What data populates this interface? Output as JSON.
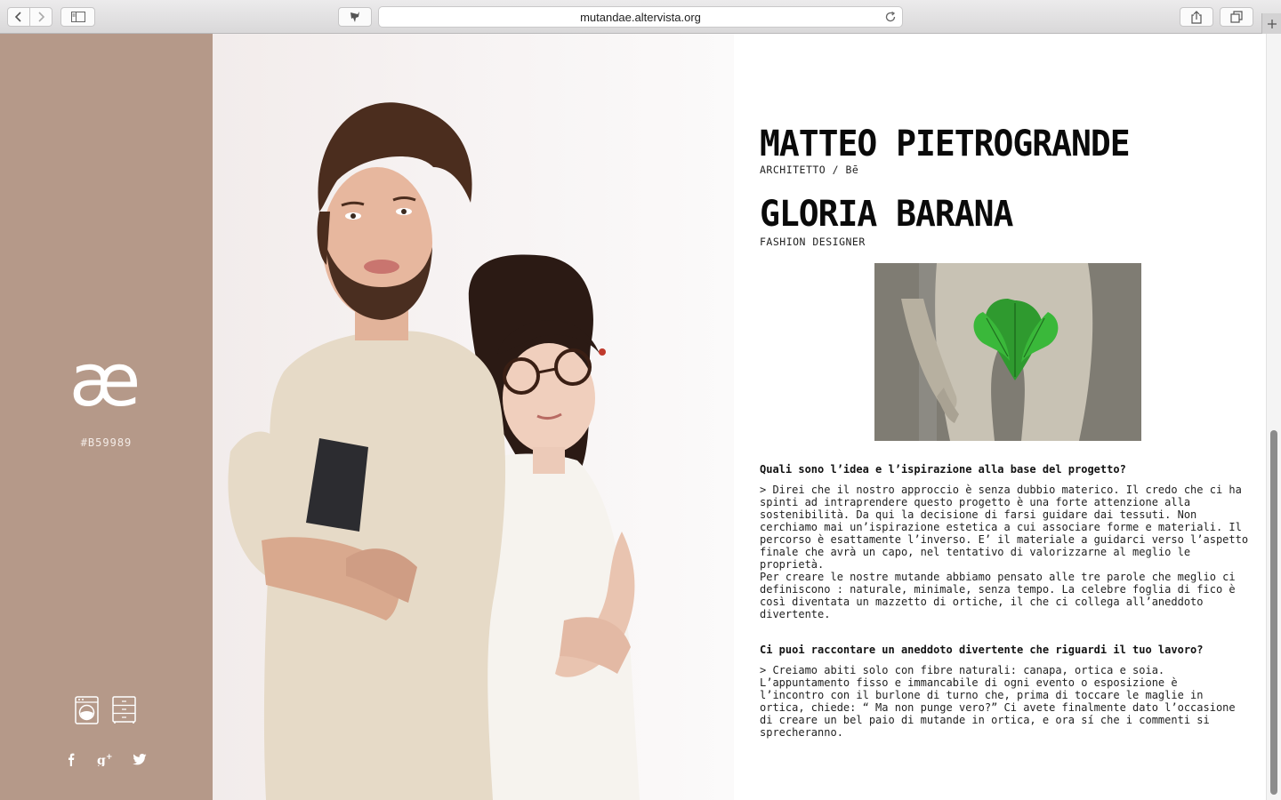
{
  "browser": {
    "url": "mutandae.altervista.org"
  },
  "sidebar": {
    "logo_glyph": "æ",
    "hex_color": "#B59989",
    "background": "#b59989",
    "tools": [
      "washing-machine-icon",
      "drawers-icon"
    ],
    "social": [
      "facebook-icon",
      "google-plus-icon",
      "twitter-icon"
    ]
  },
  "profile": {
    "person1": {
      "name": "MATTEO PIETROGRANDE",
      "role": "ARCHITETTO / Bē"
    },
    "person2": {
      "name": "GLORIA BARANA",
      "role": "FASHION DESIGNER"
    }
  },
  "interview": {
    "q1": "Quali sono l’idea e l’ispirazione alla base del progetto?",
    "a1": "> Direi che il nostro approccio è senza dubbio materico. Il credo che ci ha\nspinti ad intraprendere questo progetto è una forte attenzione alla\nsostenibilità. Da qui la decisione di farsi guidare dai tessuti. Non\ncerchiamo mai un’ispirazione estetica a cui associare forme e materiali. Il\npercorso è esattamente l’inverso. E’ il materiale a guidarci verso l’aspetto\nfinale che avrà un capo, nel tentativo di valorizzarne al meglio le\nproprietà.\nPer creare le nostre mutande abbiamo pensato alle tre parole che meglio ci\ndefiniscono : naturale, minimale, senza tempo. La celebre foglia di fico è\ncosì diventata un mazzetto di ortiche, il che ci collega all’aneddoto\ndivertente.",
    "q2": "Ci puoi raccontare un aneddoto divertente che riguardi il tuo lavoro?",
    "a2": "> Creiamo abiti solo con fibre naturali: canapa, ortica e soia.\nL’appuntamento fisso e immancabile di ogni evento o esposizione è\nl’incontro con il burlone di turno che, prima di toccare le maglie in\nortica, chiede: “ Ma non punge vero?” Ci avete finalmente dato l’occasione\ndi creare un bel paio di mutande in ortica, e ora sí che i commenti si\nsprecheranno."
  }
}
